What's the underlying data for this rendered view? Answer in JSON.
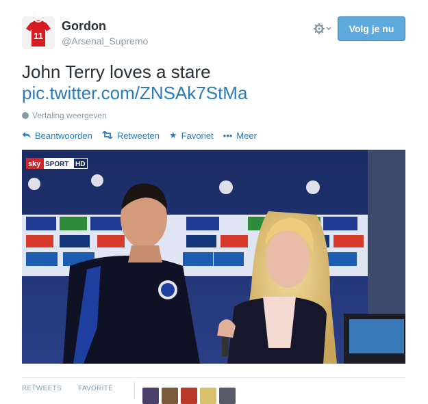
{
  "user": {
    "name": "Gordon",
    "handle": "@Arsenal_Supremo",
    "jersey_number": "11"
  },
  "header": {
    "follow_label": "Volg je nu"
  },
  "tweet": {
    "text": "John Terry loves a stare",
    "link": "pic.twitter.com/ZNSAk7StMa",
    "translate_label": "Vertaling weergeven"
  },
  "actions": {
    "reply": "Beantwoorden",
    "retweet": "Retweeten",
    "favorite": "Favoriet",
    "more": "Meer"
  },
  "media": {
    "channel_sky": "sky",
    "channel_sport": "SPORT",
    "channel_hd": "HD"
  },
  "stats": {
    "retweets_label": "RETWEETS",
    "favorites_label": "FAVORITE"
  },
  "colors": {
    "link": "#2b7bb9",
    "follow_bg": "#5ea9dd",
    "muted": "#8899a6"
  },
  "icons": [
    "gear-icon",
    "chevron-down-icon",
    "globe-icon",
    "reply-icon",
    "retweet-icon",
    "star-icon",
    "more-icon"
  ]
}
